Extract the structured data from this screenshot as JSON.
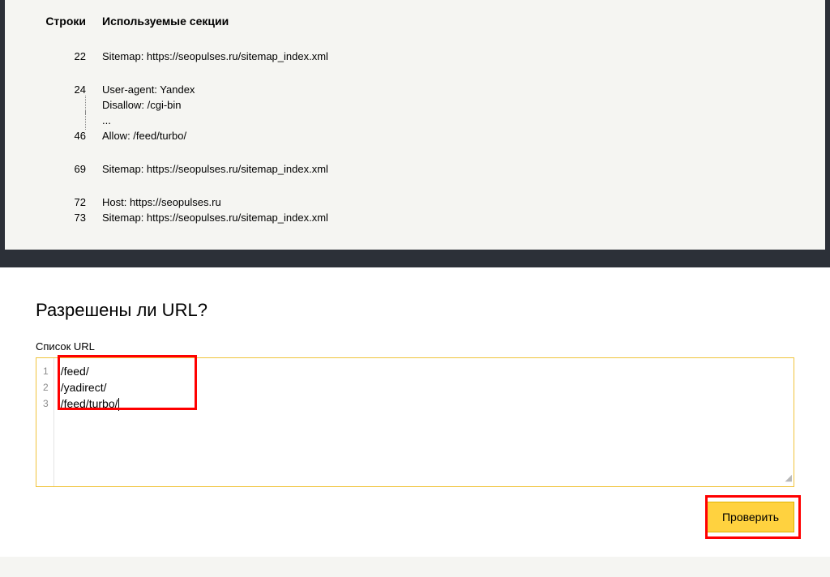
{
  "robots": {
    "header_lines": "Строки",
    "header_sections": "Используемые секции",
    "rows": [
      {
        "num": "22",
        "text": "Sitemap: https://seopulses.ru/sitemap_index.xml"
      },
      {
        "spacer": true
      },
      {
        "num": "24",
        "text": "User-agent: Yandex"
      },
      {
        "num": "",
        "text": "Disallow: /cgi-bin",
        "dotted": true
      },
      {
        "num": "",
        "text": "...",
        "dotted": true
      },
      {
        "num": "46",
        "text": "Allow: /feed/turbo/"
      },
      {
        "spacer": true
      },
      {
        "num": "69",
        "text": "Sitemap: https://seopulses.ru/sitemap_index.xml"
      },
      {
        "spacer": true
      },
      {
        "num": "72",
        "text": "Host: https://seopulses.ru"
      },
      {
        "num": "73",
        "text": "Sitemap: https://seopulses.ru/sitemap_index.xml"
      }
    ]
  },
  "url_check": {
    "heading": "Разрешены ли URL?",
    "label": "Список URL",
    "lines": [
      "/feed/",
      "/yadirect/",
      "/feed/turbo/"
    ],
    "gutter": [
      "1",
      "2",
      "3"
    ],
    "button": "Проверить"
  }
}
